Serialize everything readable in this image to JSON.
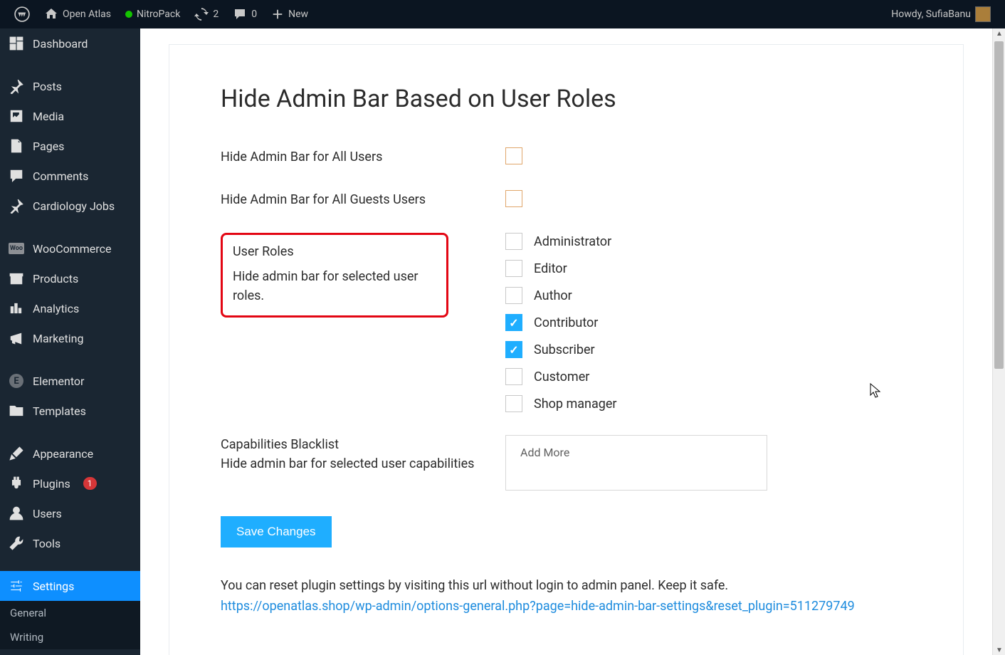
{
  "adminbar": {
    "site_name": "Open Atlas",
    "nitropack": "NitroPack",
    "updates_count": "2",
    "comments_count": "0",
    "new_label": "New",
    "greeting": "Howdy, SufiaBanu"
  },
  "sidebar": {
    "items": [
      {
        "icon": "dashboard",
        "label": "Dashboard"
      },
      {
        "icon": "pin",
        "label": "Posts"
      },
      {
        "icon": "media",
        "label": "Media"
      },
      {
        "icon": "pages",
        "label": "Pages"
      },
      {
        "icon": "comments",
        "label": "Comments"
      },
      {
        "icon": "pin",
        "label": "Cardiology Jobs"
      },
      {
        "icon": "woo",
        "label": "WooCommerce"
      },
      {
        "icon": "products",
        "label": "Products"
      },
      {
        "icon": "analytics",
        "label": "Analytics"
      },
      {
        "icon": "megaphone",
        "label": "Marketing"
      },
      {
        "icon": "elementor",
        "label": "Elementor"
      },
      {
        "icon": "folder",
        "label": "Templates"
      },
      {
        "icon": "brush",
        "label": "Appearance"
      },
      {
        "icon": "plugin",
        "label": "Plugins",
        "badge": "1"
      },
      {
        "icon": "user",
        "label": "Users"
      },
      {
        "icon": "wrench",
        "label": "Tools"
      },
      {
        "icon": "sliders",
        "label": "Settings",
        "active": true
      }
    ],
    "submenu": [
      {
        "label": "General"
      },
      {
        "label": "Writing"
      }
    ]
  },
  "page": {
    "title": "Hide Admin Bar Based on User Roles",
    "opt_all_users": "Hide Admin Bar for All Users",
    "opt_all_guests": "Hide Admin Bar for All Guests Users",
    "user_roles_title": "User Roles",
    "user_roles_sub": "Hide admin bar for selected user roles.",
    "roles": [
      {
        "label": "Administrator",
        "checked": false
      },
      {
        "label": "Editor",
        "checked": false
      },
      {
        "label": "Author",
        "checked": false
      },
      {
        "label": "Contributor",
        "checked": true
      },
      {
        "label": "Subscriber",
        "checked": true
      },
      {
        "label": "Customer",
        "checked": false
      },
      {
        "label": "Shop manager",
        "checked": false
      }
    ],
    "cap_title": "Capabilities Blacklist",
    "cap_sub": "Hide admin bar for selected user capabilities",
    "cap_placeholder": "Add More",
    "save_label": "Save Changes",
    "reset_text": "You can reset plugin settings by visiting this url without login to admin panel. Keep it safe.",
    "reset_link": "https://openatlas.shop/wp-admin/options-general.php?page=hide-admin-bar-settings&reset_plugin=511279749"
  }
}
